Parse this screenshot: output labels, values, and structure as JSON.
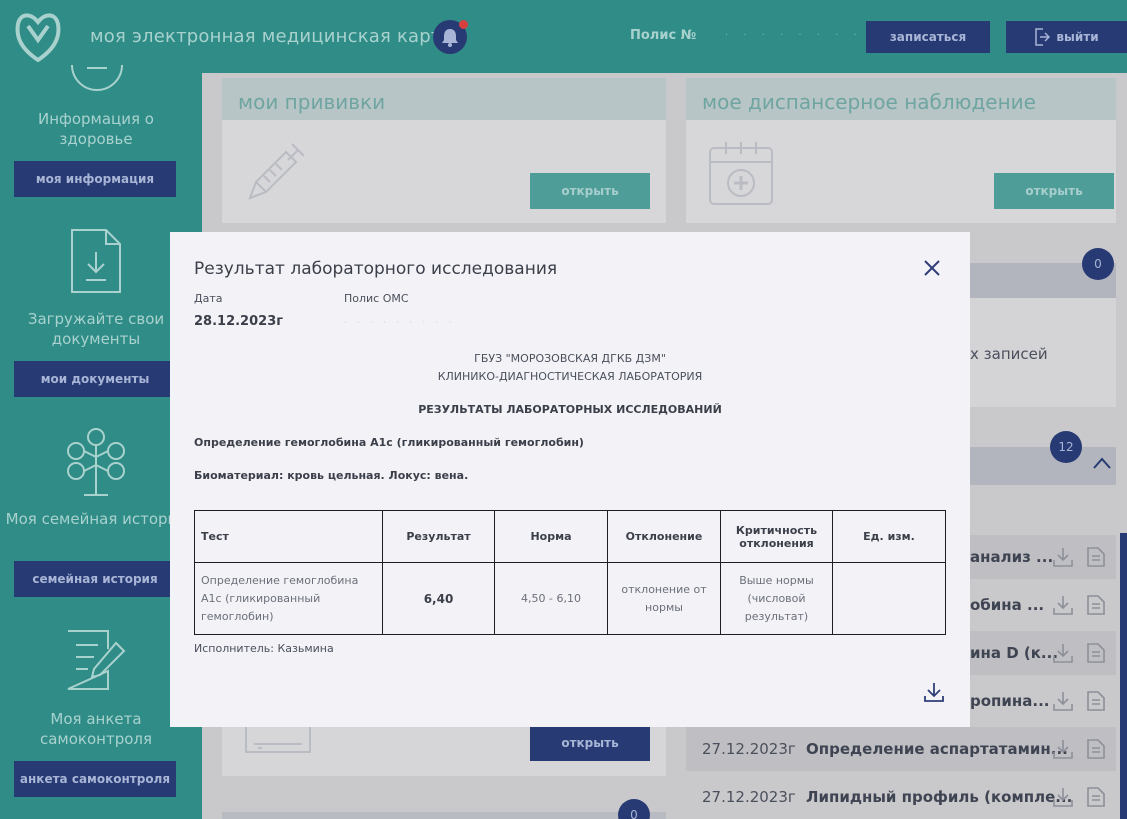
{
  "header": {
    "app_title": "моя электронная медицинская карта",
    "polis_label": "Полис №",
    "polis_value": "· · · · · · · ·",
    "book_label": "записаться",
    "exit_label": "выйти"
  },
  "sidebar": {
    "sections": [
      {
        "title": "Информация о здоровье",
        "button": "моя информация"
      },
      {
        "title": "Загружайте свои документы",
        "button": "мои документы"
      },
      {
        "title": "Моя семейная история",
        "button": "семейная история"
      },
      {
        "title": "Моя анкета самоконтроля",
        "button": "анкета самоконтроля"
      }
    ]
  },
  "cards": {
    "vaccinations": {
      "title": "мои прививки",
      "button": "открыть"
    },
    "dispensary": {
      "title": "мое диспансерное наблюдение",
      "button": "открыть"
    },
    "bottom_button": "открыть",
    "badges": [
      "0",
      "12",
      "0"
    ],
    "records_fragment": "х записей"
  },
  "bg_rows": [
    {
      "date": "",
      "text": "анализ ..."
    },
    {
      "date": "",
      "text": "обина ..."
    },
    {
      "date": "",
      "text": "ина D (к..."
    },
    {
      "date": "",
      "text": "ропина..."
    },
    {
      "date": "27.12.2023г",
      "text": "Определение аспартатамин..."
    },
    {
      "date": "27.12.2023г",
      "text": "Липидный профиль (компле..."
    }
  ],
  "modal": {
    "title": "Результат лабораторного исследования",
    "date_label": "Дата",
    "date_value": "28.12.2023г",
    "polis_label": "Полис ОМС",
    "polis_value": "· · · · · · · · ·",
    "org_line1": "ГБУЗ \"МОРОЗОВСКАЯ ДГКБ ДЗМ\"",
    "org_line2": "КЛИНИКО-ДИАГНОСТИЧЕСКАЯ ЛАБОРАТОРИЯ",
    "results_heading": "РЕЗУЛЬТАТЫ ЛАБОРАТОРНЫХ ИССЛЕДОВАНИЙ",
    "test_name": "Определение гемоглобина A1c (гликированный гемоглобин)",
    "biomaterial": "Биоматериал: кровь цельная. Локус: вена.",
    "table": {
      "headers": [
        "Тест",
        "Результат",
        "Норма",
        "Отклонение",
        "Критичность отклонения",
        "Ед. изм."
      ],
      "row": [
        "Определение гемоглобина A1c (гликированный гемоглобин)",
        "6,40",
        "4,50 - 6,10",
        "отклонение от нормы",
        "Выше нормы (числовой результат)",
        ""
      ]
    },
    "executor": "Исполнитель: Казьмина"
  }
}
